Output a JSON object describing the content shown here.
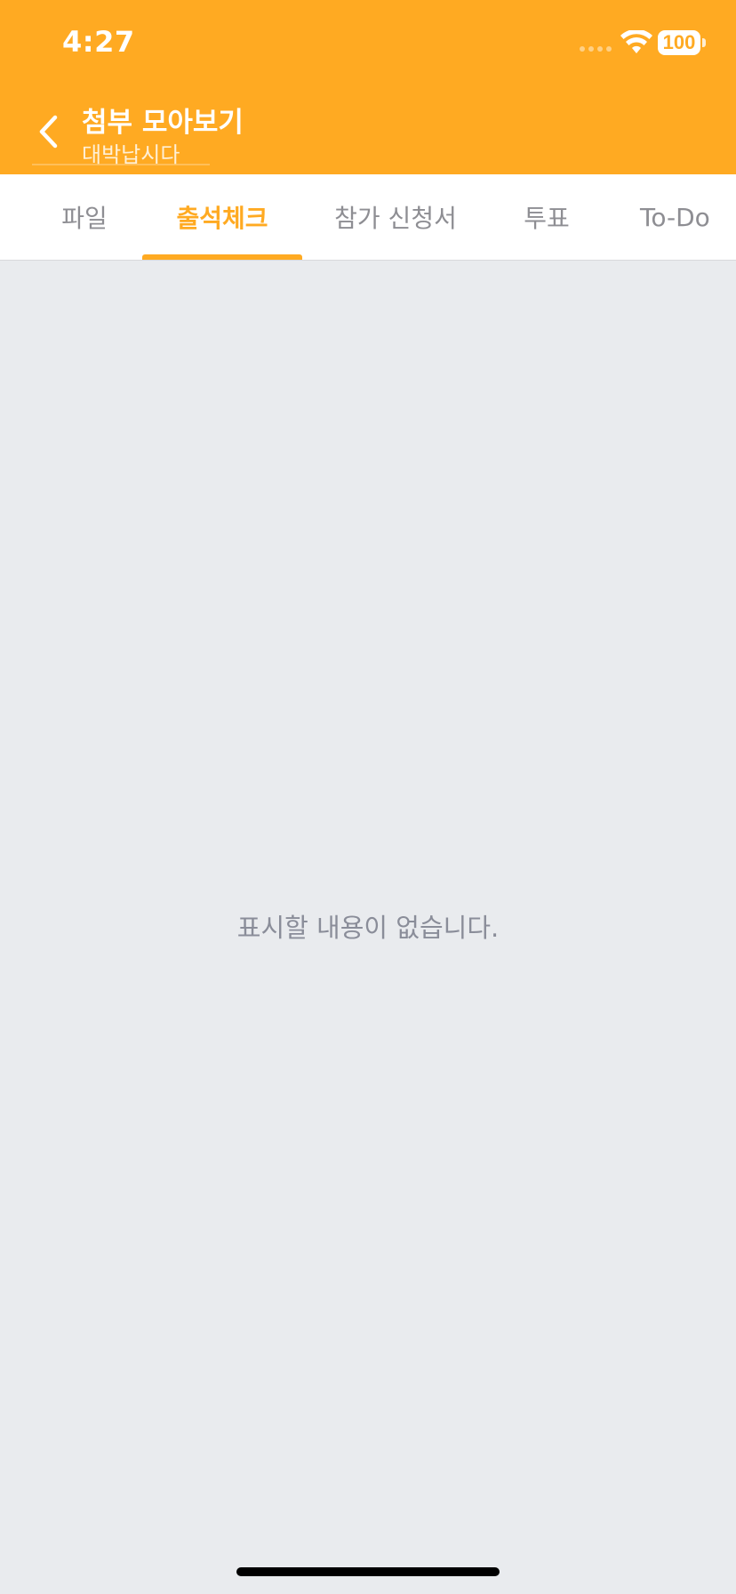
{
  "status_bar": {
    "time": "4:27",
    "battery": "100"
  },
  "nav": {
    "title": "첨부 모아보기",
    "subtitle": "대박납시다"
  },
  "tabs": [
    {
      "label": "파일",
      "active": false
    },
    {
      "label": "출석체크",
      "active": true
    },
    {
      "label": "참가 신청서",
      "active": false
    },
    {
      "label": "투표",
      "active": false
    },
    {
      "label": "To-Do",
      "active": false
    }
  ],
  "content": {
    "empty_message": "표시할 내용이 없습니다."
  },
  "colors": {
    "accent": "#FFAA22",
    "background": "#E9EBEE",
    "tab_inactive": "#8E8E93",
    "empty_text": "#8A8D99"
  },
  "icons": {
    "back": "chevron-left-icon",
    "wifi": "wifi-icon",
    "battery": "battery-icon"
  }
}
